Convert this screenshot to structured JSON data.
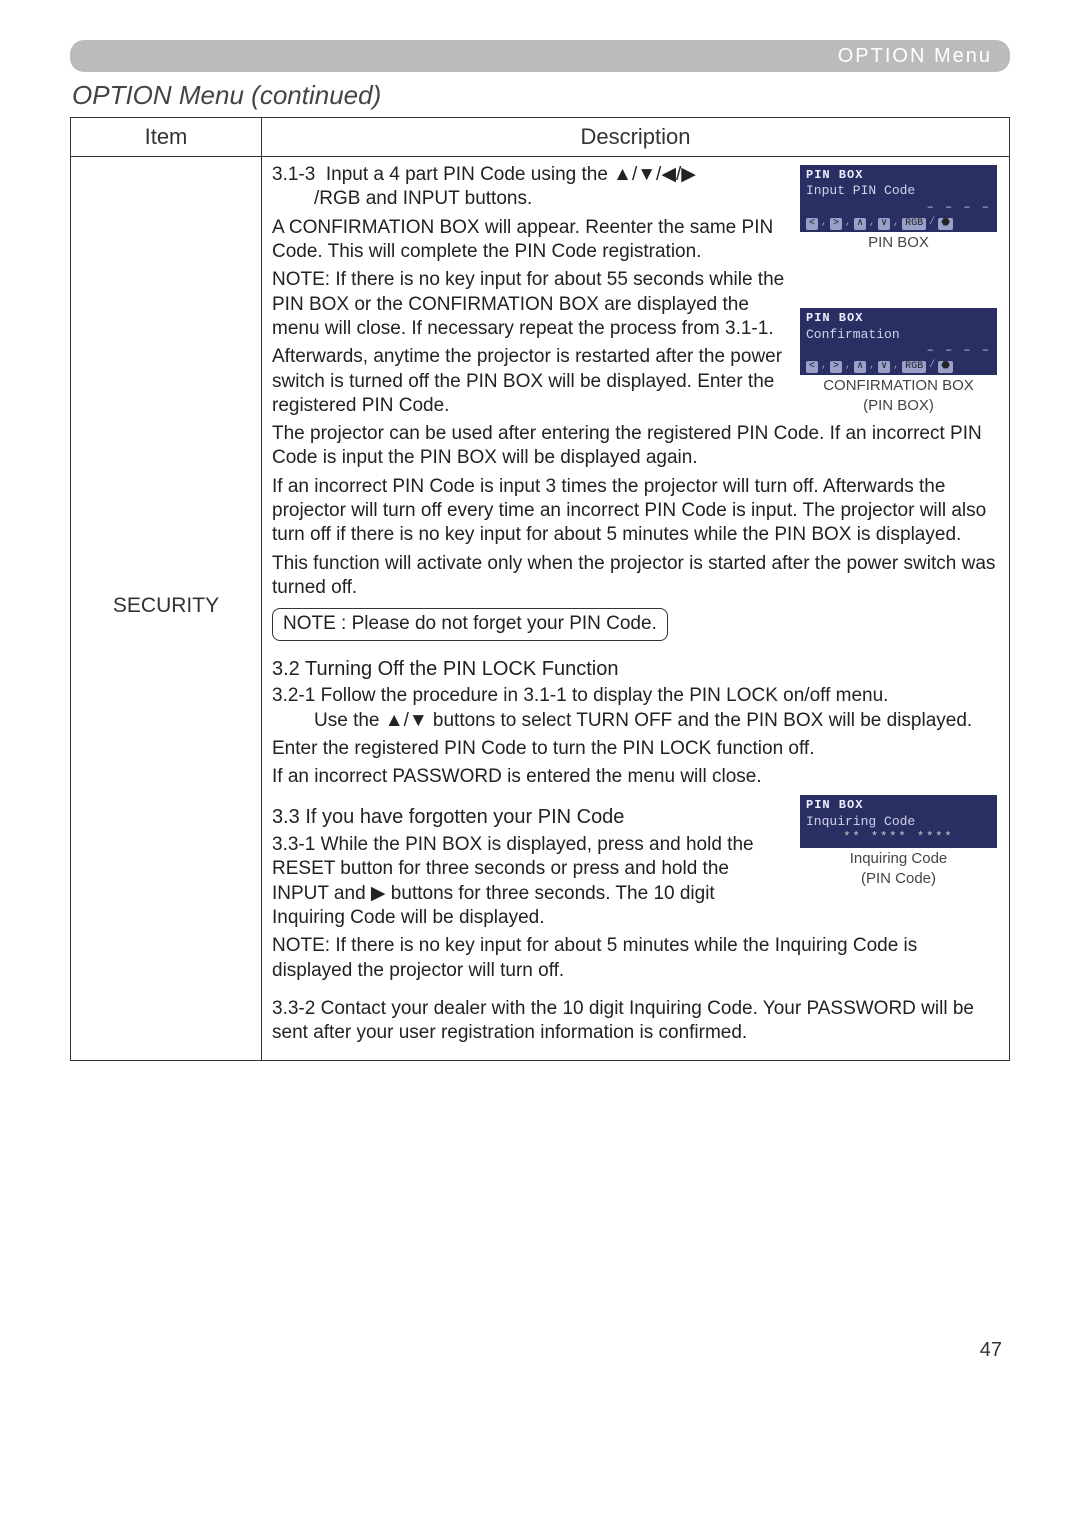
{
  "header": {
    "label": "OPTION Menu"
  },
  "section_title": "OPTION Menu (continued)",
  "table": {
    "headers": {
      "item": "Item",
      "description": "Description"
    },
    "item_label": "SECURITY"
  },
  "desc": {
    "p313_lead": "3.1-3",
    "p313_a": "Input a 4 part PIN Code using the ▲/▼/◀/▶",
    "p313_b": "/RGB and INPUT buttons.",
    "p313_c": "A CONFIRMATION BOX will appear. Reenter the same PIN Code. This will complete the PIN Code registration.",
    "p313_note": "NOTE: If there is no key input for about 55 seconds while the PIN BOX or the CONFIRMATION BOX are displayed the menu will close. If necessary repeat the process from 3.1-1.",
    "p313_after": "Afterwards, anytime the projector is restarted after the power switch is turned off the PIN BOX will be displayed. Enter the registered PIN Code.",
    "p313_used": "The projector can be used after entering the registered PIN Code. If an incorrect PIN Code is input the PIN BOX will be displayed again.",
    "p313_three": "If an incorrect PIN Code is input 3 times the projector will turn off. Afterwards the projector will turn off every time an incorrect PIN Code is input. The projector will also turn off if there is no key input for about 5 minutes while the PIN BOX is displayed.",
    "p313_activate": "This function will activate only when the projector is started after the power switch was turned off.",
    "note_box": "NOTE : Please do not forget your PIN Code.",
    "h32": "3.2 Turning Off the PIN LOCK Function",
    "p321_lead": "3.2-1",
    "p321_a": "Follow the procedure in 3.1-1 to display the PIN LOCK on/off menu.",
    "p321_b": "Use the ▲/▼ buttons to select TURN OFF and the PIN BOX will be displayed.",
    "p321_c": "Enter the registered PIN Code to turn the PIN LOCK function off.",
    "p321_d": "If an incorrect PASSWORD is entered the  menu will close.",
    "h33": "3.3 If you have forgotten your PIN Code",
    "p331_lead": "3.3-1",
    "p331_a": "While the PIN BOX is displayed, press and hold the RESET button for three seconds or press and hold the INPUT and ▶ buttons for three seconds. The 10 digit Inquiring Code will be displayed.",
    "p331_note": "NOTE: If there is no key input for about 5 minutes while the Inquiring Code is displayed the projector will turn off.",
    "p332_lead": "3.3-2",
    "p332": "Contact your dealer with the 10 digit Inquiring Code. Your PASSWORD will be sent after your user registration information is confirmed."
  },
  "diagrams": {
    "pinbox1": {
      "title": "PIN BOX",
      "line": "Input PIN Code",
      "value": "– – – –"
    },
    "pinbox1_caption": "PIN BOX",
    "pinbox2": {
      "title": "PIN BOX",
      "line": "Confirmation",
      "value": "– – – –"
    },
    "pinbox2_caption1": "CONFIRMATION BOX",
    "pinbox2_caption2": "(PIN BOX)",
    "inq": {
      "title": "PIN BOX",
      "line": "Inquiring Code",
      "value": "** **** ****"
    },
    "inq_caption1": "Inquiring Code",
    "inq_caption2": "(PIN Code)",
    "keys": {
      "l": "<",
      "r": ">",
      "u": "∧",
      "d": "∨",
      "rgb": "RGB",
      "inp": "⬣"
    }
  },
  "page_number": "47"
}
